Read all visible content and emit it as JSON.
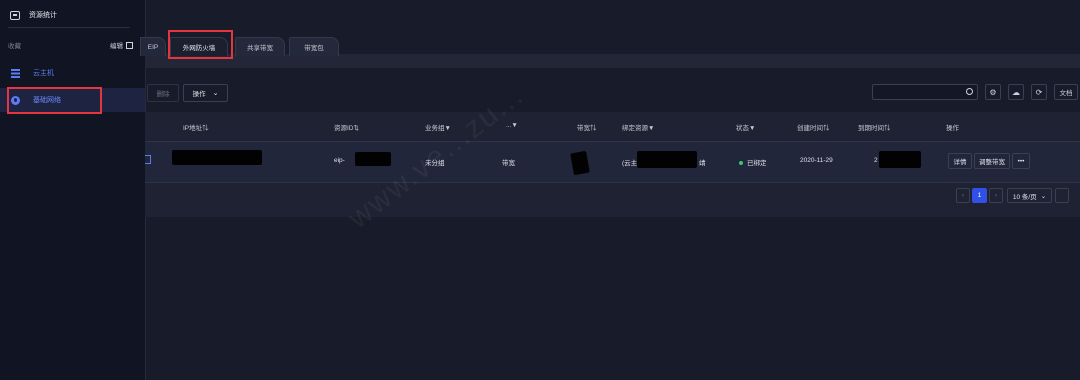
{
  "sidebar": {
    "title": "资源统计",
    "favorites_label": "收藏",
    "edit_label": "编辑",
    "items": [
      {
        "label": "云主机",
        "icon": "server-icon"
      },
      {
        "label": "基础网络",
        "icon": "network-icon"
      }
    ]
  },
  "tabs": [
    "EIP",
    "外网防火墙",
    "共享带宽",
    "带宽包"
  ],
  "toolbar": {
    "disabled_label": "删除",
    "actions_label": "操作"
  },
  "right_tools": {
    "docs_label": "文档"
  },
  "table": {
    "headers": [
      "IP地址⇅",
      "资源ID⇅",
      "业务组▼",
      "...▼",
      "带宽⇅",
      "绑定资源▼",
      "状态▼",
      "创建时间⇅",
      "到期时间⇅",
      "操作"
    ],
    "row": {
      "ip_address": "",
      "resource_id": "eip-",
      "business_group": "未分组",
      "type": "带宽",
      "bandwidth": "",
      "bound_resource": "(云主",
      "bound_resource_tail": "靖",
      "status": "已绑定",
      "created": "2020-11-29",
      "expires": "2",
      "actions": [
        "详情",
        "调整带宽",
        "•••"
      ]
    }
  },
  "pagination": {
    "current_page": "1",
    "page_size_label": "10 条/页"
  },
  "watermark_text": "www.ve...zu...",
  "colors": {
    "accent": "#4d6bff",
    "highlight_box": "#e5353f",
    "status_green": "#2ecc71"
  }
}
